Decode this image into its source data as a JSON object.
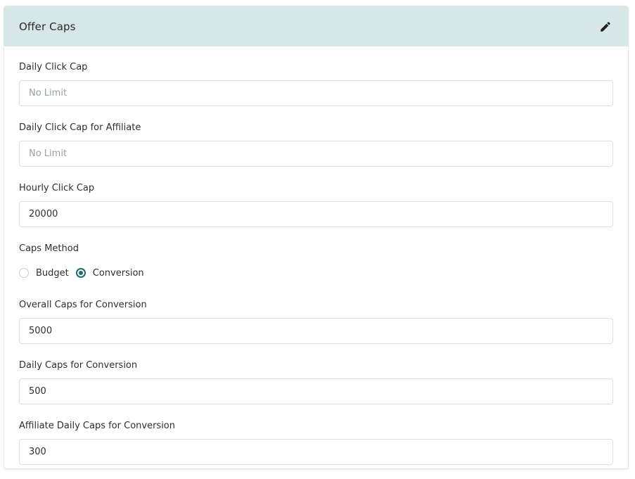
{
  "card": {
    "title": "Offer Caps",
    "edit_icon": "pencil-icon"
  },
  "fields": {
    "daily_click_cap": {
      "label": "Daily Click Cap",
      "value": "",
      "placeholder": "No Limit"
    },
    "daily_click_cap_affiliate": {
      "label": "Daily Click Cap for Affiliate",
      "value": "",
      "placeholder": "No Limit"
    },
    "hourly_click_cap": {
      "label": "Hourly Click Cap",
      "value": "20000",
      "placeholder": ""
    },
    "caps_method": {
      "label": "Caps Method",
      "options": [
        {
          "label": "Budget",
          "checked": false
        },
        {
          "label": "Conversion",
          "checked": true
        }
      ]
    },
    "overall_caps_conversion": {
      "label": "Overall Caps for Conversion",
      "value": "5000",
      "placeholder": ""
    },
    "daily_caps_conversion": {
      "label": "Daily Caps for Conversion",
      "value": "500",
      "placeholder": ""
    },
    "affiliate_daily_caps_conversion": {
      "label": "Affiliate Daily Caps for Conversion",
      "value": "300",
      "placeholder": ""
    }
  },
  "colors": {
    "header_bg": "#d7e7e7",
    "radio_accent": "#1d6a70"
  }
}
